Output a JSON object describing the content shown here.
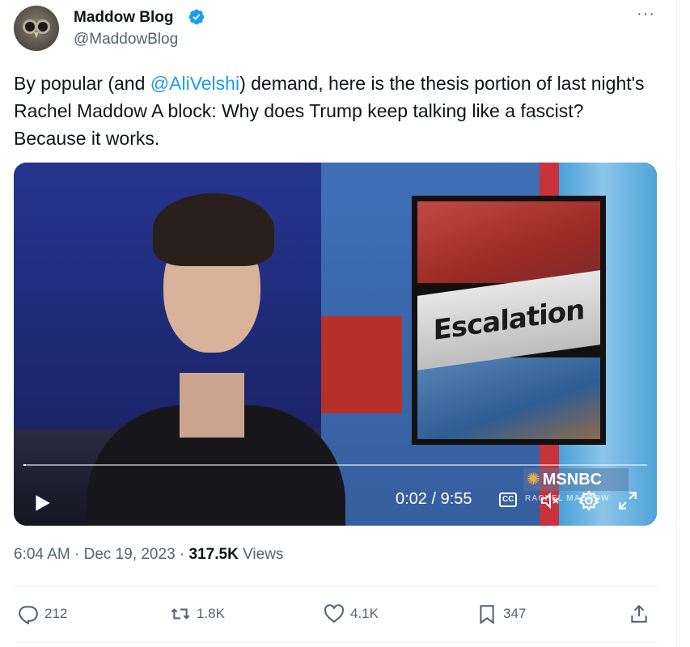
{
  "author": {
    "name": "Maddow Blog",
    "handle": "@MaddowBlog",
    "avatar_icon": "owl-avatar",
    "verified_icon": "verified-badge-icon"
  },
  "more_label": "···",
  "tweet": {
    "text_before": "By popular (and ",
    "mention": "@AliVelshi",
    "text_after": ") demand, here is the thesis portion of last night's Rachel Maddow A block: Why does Trump keep talking like a fascist? Because it works."
  },
  "video": {
    "graphic_label": "Escalation",
    "time": "0:02 / 9:55",
    "progress_fraction": 0.0034,
    "network_logo": "MSNBC",
    "lower_third": "RACHEL MADDOW",
    "cc_label": "CC",
    "muted": true
  },
  "meta": {
    "time": "6:04 AM",
    "separator": " · ",
    "date": "Dec 19, 2023",
    "views_count": "317.5K",
    "views_label": "Views"
  },
  "actions": {
    "replies": "212",
    "reposts": "1.8K",
    "likes": "4.1K",
    "bookmarks": "347"
  },
  "colors": {
    "accent": "#1d9bf0",
    "text": "#0f1419",
    "secondary": "#536471"
  }
}
